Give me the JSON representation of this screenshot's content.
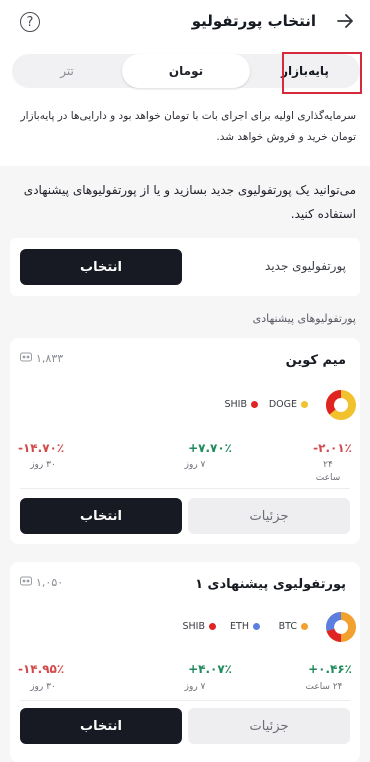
{
  "header": {
    "title": "انتخاب پورتفولیو",
    "back_icon": "arrow-right-icon",
    "help_icon": "question-circle-icon",
    "help_glyph": "?"
  },
  "tabs": [
    {
      "label": "پایه‌بازار",
      "active": true
    },
    {
      "label": "تومان",
      "active": false
    },
    {
      "label": "تتر",
      "active": false
    }
  ],
  "description": "سرمایه‌گذاری اولیه برای اجرای بات با تومان خواهد بود و دارایی‌ها در پایه‌بازار تومان خرید و فروش خواهد شد.",
  "intro": "می‌توانید یک پورتفولیوی جدید بسازید و یا از پورتفولیوهای پیشنهادی استفاده کنید.",
  "new_portfolio": {
    "label": "پورتفولیوی جدید",
    "button": "انتخاب"
  },
  "suggested_title": "پورتفولیوهای پیشنهادی",
  "cards": [
    {
      "title": "میم کوین",
      "users": "۱,۸۳۳",
      "coins": [
        {
          "name": "DOGE",
          "color": "#f2c12e"
        },
        {
          "name": "SHIB",
          "color": "#e02424"
        }
      ],
      "stats": [
        {
          "value": "-۲.۰۱٪",
          "label1": "۲۴",
          "label2": "ساعت",
          "color": "red"
        },
        {
          "value": "+۷.۷۰٪",
          "label1": "۷ روز",
          "label2": "",
          "color": "green"
        },
        {
          "value": "-۱۴.۷۰٪",
          "label1": "۳۰ روز",
          "label2": "",
          "color": "red"
        }
      ],
      "details": "جزئیات",
      "select": "انتخاب"
    },
    {
      "title": "پورتفولیوی پیشنهادی ۱",
      "users": "۱,۰۵۰",
      "coins": [
        {
          "name": "BTC",
          "color": "#f2a12e"
        },
        {
          "name": "ETH",
          "color": "#5b7fe0"
        },
        {
          "name": "SHIB",
          "color": "#e02424"
        }
      ],
      "stats": [
        {
          "value": "+۰.۴۶٪",
          "label1": "۲۴ ساعت",
          "label2": "",
          "color": "green"
        },
        {
          "value": "+۴.۰۷٪",
          "label1": "۷ روز",
          "label2": "",
          "color": "green"
        },
        {
          "value": "-۱۴.۹۵٪",
          "label1": "۳۰ روز",
          "label2": "",
          "color": "red"
        }
      ],
      "details": "جزئیات",
      "select": "انتخاب"
    }
  ],
  "colors": {
    "accent_dark": "#171a22",
    "highlight": "#d6293b"
  }
}
